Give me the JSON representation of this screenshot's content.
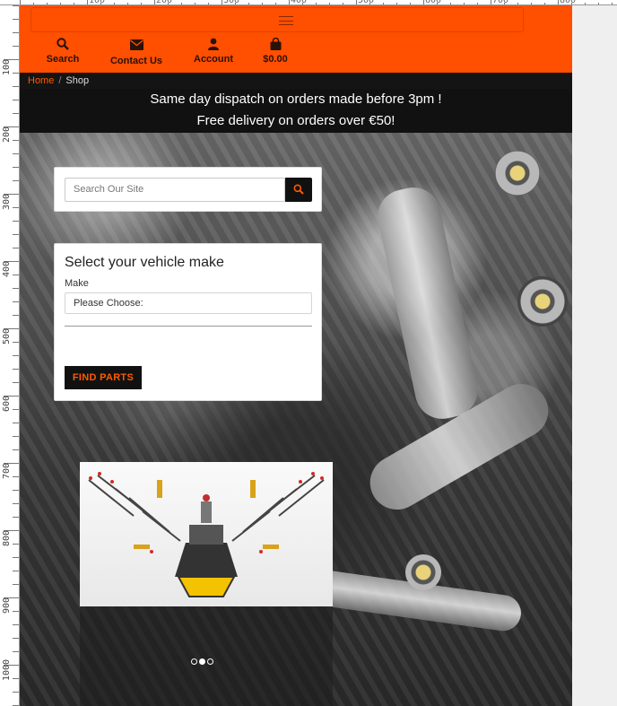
{
  "ruler": {
    "top_labels": [
      "100",
      "200",
      "300",
      "400",
      "500",
      "600",
      "700",
      "800"
    ],
    "left_labels": [
      "100",
      "200",
      "300",
      "400",
      "500",
      "600",
      "700",
      "800",
      "900",
      "1000"
    ]
  },
  "nav": {
    "items": [
      {
        "label": "Search",
        "icon": "search-icon"
      },
      {
        "label": "Contact Us",
        "icon": "envelope-icon"
      },
      {
        "label": "Account",
        "icon": "user-icon"
      },
      {
        "label": "$0.00",
        "icon": "shopping-bag-icon"
      }
    ]
  },
  "breadcrumb": {
    "home": "Home",
    "separator": "/",
    "current": "Shop"
  },
  "promo": {
    "line1": "Same day dispatch on orders made before 3pm !",
    "line2": "Free delivery on orders over €50!"
  },
  "search": {
    "placeholder": "Search Our Site"
  },
  "vehicle": {
    "title": "Select your vehicle make",
    "make_label": "Make",
    "make_value": "Please Choose:",
    "button": "FIND PARTS"
  },
  "carousel": {
    "slide_count": 3,
    "active_index": 1
  },
  "colors": {
    "brand_orange": "#ff4f00",
    "dark": "#111111",
    "accent_text": "#ff5a00"
  }
}
